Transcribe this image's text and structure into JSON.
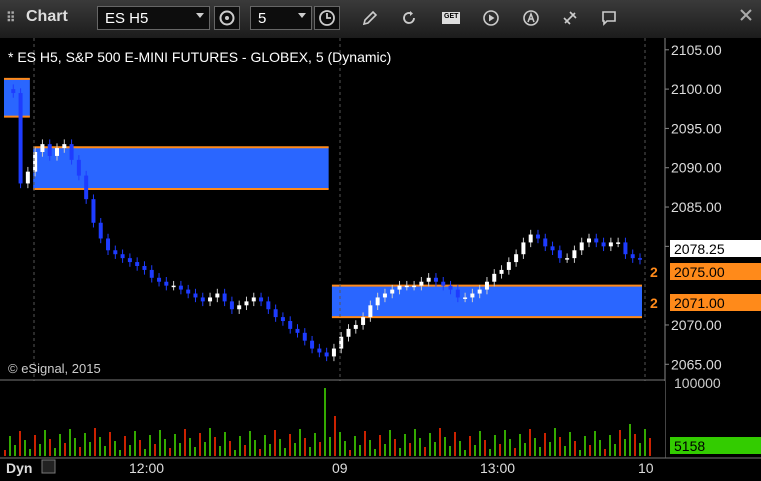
{
  "app": {
    "title": "Chart"
  },
  "toolbar": {
    "symbol": "ES H5",
    "interval": "5",
    "get_badge": "GET"
  },
  "chart": {
    "header": "* ES H5, S&P 500 E-MINI FUTURES - GLOBEX, 5 (Dynamic)",
    "copyright": "© eSignal, 2015",
    "price_ticks": [
      {
        "label": "2105.00",
        "value": 2105
      },
      {
        "label": "2100.00",
        "value": 2100
      },
      {
        "label": "2095.00",
        "value": 2095
      },
      {
        "label": "2090.00",
        "value": 2090
      },
      {
        "label": "2085.00",
        "value": 2085
      },
      {
        "label": "2080.00",
        "value": 2080
      },
      {
        "label": "2070.00",
        "value": 2070
      },
      {
        "label": "2065.00",
        "value": 2065
      }
    ],
    "last_price": "2078.25",
    "level_markers": [
      {
        "tag": "2",
        "label": "2075.00",
        "value": 2075
      },
      {
        "tag": "2",
        "label": "2071.00",
        "value": 2071
      }
    ],
    "volume_tick": "100000",
    "last_volume": "5158",
    "time_labels": [
      "12:00",
      "09",
      "13:00",
      "10"
    ],
    "interval_selector": "Dyn",
    "colors": {
      "zone": "#2a66ff",
      "zone_border": "#ff8a1a",
      "up": "#ffffff",
      "down": "#1e3cff",
      "volume_badge": "#33cc00",
      "marker": "#ff8a1a"
    }
  },
  "chart_data": {
    "type": "candlestick",
    "ylim": [
      2063,
      2106.5
    ],
    "price_points": [
      2100,
      2099.5,
      2088,
      2089.5,
      2092,
      2093,
      2091.5,
      2092.5,
      2093,
      2091,
      2089,
      2086,
      2083,
      2081,
      2079.5,
      2079,
      2078.5,
      2078,
      2077.5,
      2077,
      2076,
      2075.5,
      2075,
      2075,
      2074.5,
      2074,
      2073.5,
      2073,
      2073.5,
      2074,
      2073,
      2072,
      2072.5,
      2073,
      2073.5,
      2073,
      2072,
      2071,
      2070.5,
      2069.5,
      2069,
      2068,
      2067,
      2066.5,
      2066,
      2067,
      2068.5,
      2069.5,
      2070,
      2071,
      2072.5,
      2073.5,
      2074,
      2074.5,
      2075,
      2075,
      2075,
      2075.5,
      2076,
      2075.5,
      2075,
      2074.5,
      2073.5,
      2073.5,
      2074,
      2074.5,
      2075.5,
      2076.5,
      2077,
      2078,
      2079,
      2080.5,
      2081.5,
      2081,
      2080,
      2079.5,
      2078.5,
      2078.5,
      2079.5,
      2080.5,
      2081,
      2080.5,
      2080,
      2080.5,
      2080.5,
      2079,
      2078.5,
      2078.3
    ],
    "zones": [
      {
        "from": 0,
        "to": 3,
        "top": 2101.3,
        "bottom": 2096.5
      },
      {
        "from": 4,
        "to": 44,
        "top": 2092.6,
        "bottom": 2087.3
      },
      {
        "from": 45,
        "to": 87,
        "top": 2075,
        "bottom": 2071
      }
    ]
  }
}
